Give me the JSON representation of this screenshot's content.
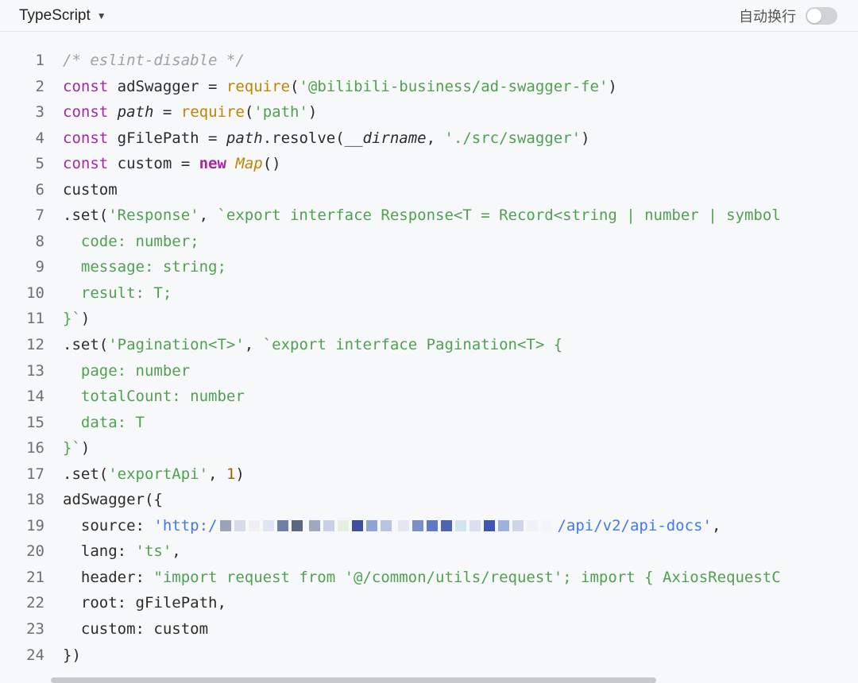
{
  "toolbar": {
    "language": "TypeScript",
    "wrap_label": "自动换行",
    "wrap_enabled": false
  },
  "code": {
    "line_numbers": [
      "1",
      "2",
      "3",
      "4",
      "5",
      "6",
      "7",
      "8",
      "9",
      "10",
      "11",
      "12",
      "13",
      "14",
      "15",
      "16",
      "17",
      "18",
      "19",
      "20",
      "21",
      "22",
      "23",
      "24"
    ],
    "l1": "/* eslint-disable */",
    "l2": {
      "kw": "const",
      "name": " adSwagger = ",
      "fn": "require",
      "p1": "(",
      "str": "'@bilibili-business/ad-swagger-fe'",
      "p2": ")"
    },
    "l3": {
      "kw": "const",
      "name": " ",
      "it": "path",
      "eq": " = ",
      "fn": "require",
      "p1": "(",
      "str": "'path'",
      "p2": ")"
    },
    "l4": {
      "kw": "const",
      "name": " gFilePath = ",
      "it": "path",
      "rest": ".resolve(",
      "it2": "__dirname",
      "comma": ", ",
      "str": "'./src/swagger'",
      "p2": ")"
    },
    "l5": {
      "kw": "const",
      "name": " custom = ",
      "new": "new",
      "sp": " ",
      "cls": "Map",
      "p": "()"
    },
    "l6": "custom",
    "l7": {
      "a": ".set(",
      "s1": "'Response'",
      "b": ", ",
      "t": "`export interface Response<T = Record<string | number | symbol"
    },
    "l8": "  code: number;",
    "l9": "  message: string;",
    "l10": "  result: T;",
    "l11": "}`",
    "l11b": ")",
    "l12": {
      "a": ".set(",
      "s1": "'Pagination<T>'",
      "b": ", ",
      "t": "`export interface Pagination<T> {"
    },
    "l13": "  page: number",
    "l14": "  totalCount: number",
    "l15": "  data: T",
    "l16": "}`",
    "l16b": ")",
    "l17": {
      "a": ".set(",
      "s1": "'exportApi'",
      "b": ", ",
      "num": "1",
      "c": ")"
    },
    "l18": "adSwagger({",
    "l19": {
      "key": "  source: ",
      "url1": "'http:/",
      "url2": "/api/v2/api-docs'",
      "end": ","
    },
    "l20": {
      "key": "  lang: ",
      "str": "'ts'",
      "end": ","
    },
    "l21": {
      "key": "  header: ",
      "str": "\"import request from '@/common/utils/request'; import { AxiosRequestC"
    },
    "l22": "  root: gFilePath,",
    "l23": "  custom: custom",
    "l24": "})"
  },
  "colors": {
    "keyword": "#a626a4",
    "function": "#c18401",
    "string": "#50a14f",
    "comment": "#a0a1a7",
    "url": "#4078f2"
  },
  "icons": {
    "language_caret": "caret-down-icon"
  }
}
